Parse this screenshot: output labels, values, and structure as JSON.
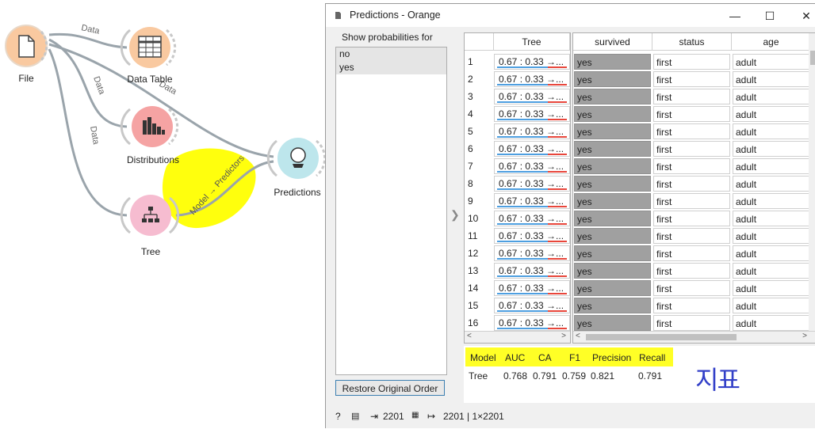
{
  "canvas": {
    "nodes": [
      {
        "id": "file",
        "label": "File",
        "icon": "file-icon",
        "color": "#f9c9a0"
      },
      {
        "id": "data-table",
        "label": "Data Table",
        "icon": "table-icon",
        "color": "#f9c9a0"
      },
      {
        "id": "distributions",
        "label": "Distributions",
        "icon": "bar-chart-icon",
        "color": "#f5a3a3"
      },
      {
        "id": "tree",
        "label": "Tree",
        "icon": "tree-icon",
        "color": "#f6bcd0"
      },
      {
        "id": "predictions",
        "label": "Predictions",
        "icon": "crystal-ball-icon",
        "color": "#bde6ec"
      }
    ],
    "links": [
      {
        "label": "Data"
      },
      {
        "label": "Data"
      },
      {
        "label": "Data"
      },
      {
        "label": "Data"
      },
      {
        "label": "Model → Predictors"
      }
    ]
  },
  "window": {
    "title": "Predictions - Orange",
    "minimize": "—",
    "maximize": "☐",
    "close": "✕",
    "show_probabilities_label": "Show probabilities for",
    "probability_options": [
      "no",
      "yes"
    ],
    "restore_button": "Restore Original Order",
    "prediction_header": "Tree",
    "data_headers": [
      "survived",
      "status",
      "age"
    ],
    "rows": [
      {
        "n": "1",
        "pred": "0.67 : 0.33 →...",
        "survived": "yes",
        "status": "first",
        "age": "adult"
      },
      {
        "n": "2",
        "pred": "0.67 : 0.33 →...",
        "survived": "yes",
        "status": "first",
        "age": "adult"
      },
      {
        "n": "3",
        "pred": "0.67 : 0.33 →...",
        "survived": "yes",
        "status": "first",
        "age": "adult"
      },
      {
        "n": "4",
        "pred": "0.67 : 0.33 →...",
        "survived": "yes",
        "status": "first",
        "age": "adult"
      },
      {
        "n": "5",
        "pred": "0.67 : 0.33 →...",
        "survived": "yes",
        "status": "first",
        "age": "adult"
      },
      {
        "n": "6",
        "pred": "0.67 : 0.33 →...",
        "survived": "yes",
        "status": "first",
        "age": "adult"
      },
      {
        "n": "7",
        "pred": "0.67 : 0.33 →...",
        "survived": "yes",
        "status": "first",
        "age": "adult"
      },
      {
        "n": "8",
        "pred": "0.67 : 0.33 →...",
        "survived": "yes",
        "status": "first",
        "age": "adult"
      },
      {
        "n": "9",
        "pred": "0.67 : 0.33 →...",
        "survived": "yes",
        "status": "first",
        "age": "adult"
      },
      {
        "n": "10",
        "pred": "0.67 : 0.33 →...",
        "survived": "yes",
        "status": "first",
        "age": "adult"
      },
      {
        "n": "11",
        "pred": "0.67 : 0.33 →...",
        "survived": "yes",
        "status": "first",
        "age": "adult"
      },
      {
        "n": "12",
        "pred": "0.67 : 0.33 →...",
        "survived": "yes",
        "status": "first",
        "age": "adult"
      },
      {
        "n": "13",
        "pred": "0.67 : 0.33 →...",
        "survived": "yes",
        "status": "first",
        "age": "adult"
      },
      {
        "n": "14",
        "pred": "0.67 : 0.33 →...",
        "survived": "yes",
        "status": "first",
        "age": "adult"
      },
      {
        "n": "15",
        "pred": "0.67 : 0.33 →...",
        "survived": "yes",
        "status": "first",
        "age": "adult"
      },
      {
        "n": "16",
        "pred": "0.67 : 0.33 →...",
        "survived": "yes",
        "status": "first",
        "age": "adult"
      }
    ],
    "scores": {
      "headers": [
        "Model",
        "AUC",
        "CA",
        "F1",
        "Precision",
        "Recall"
      ],
      "values": [
        "Tree",
        "0.768",
        "0.791",
        "0.759",
        "0.821",
        "0.791"
      ]
    },
    "status": {
      "input_count": "2201",
      "output_text": "2201 | 1×2201"
    }
  },
  "annotations": {
    "handwritten_note": "지표",
    "highlight_color": "#ffff00"
  }
}
